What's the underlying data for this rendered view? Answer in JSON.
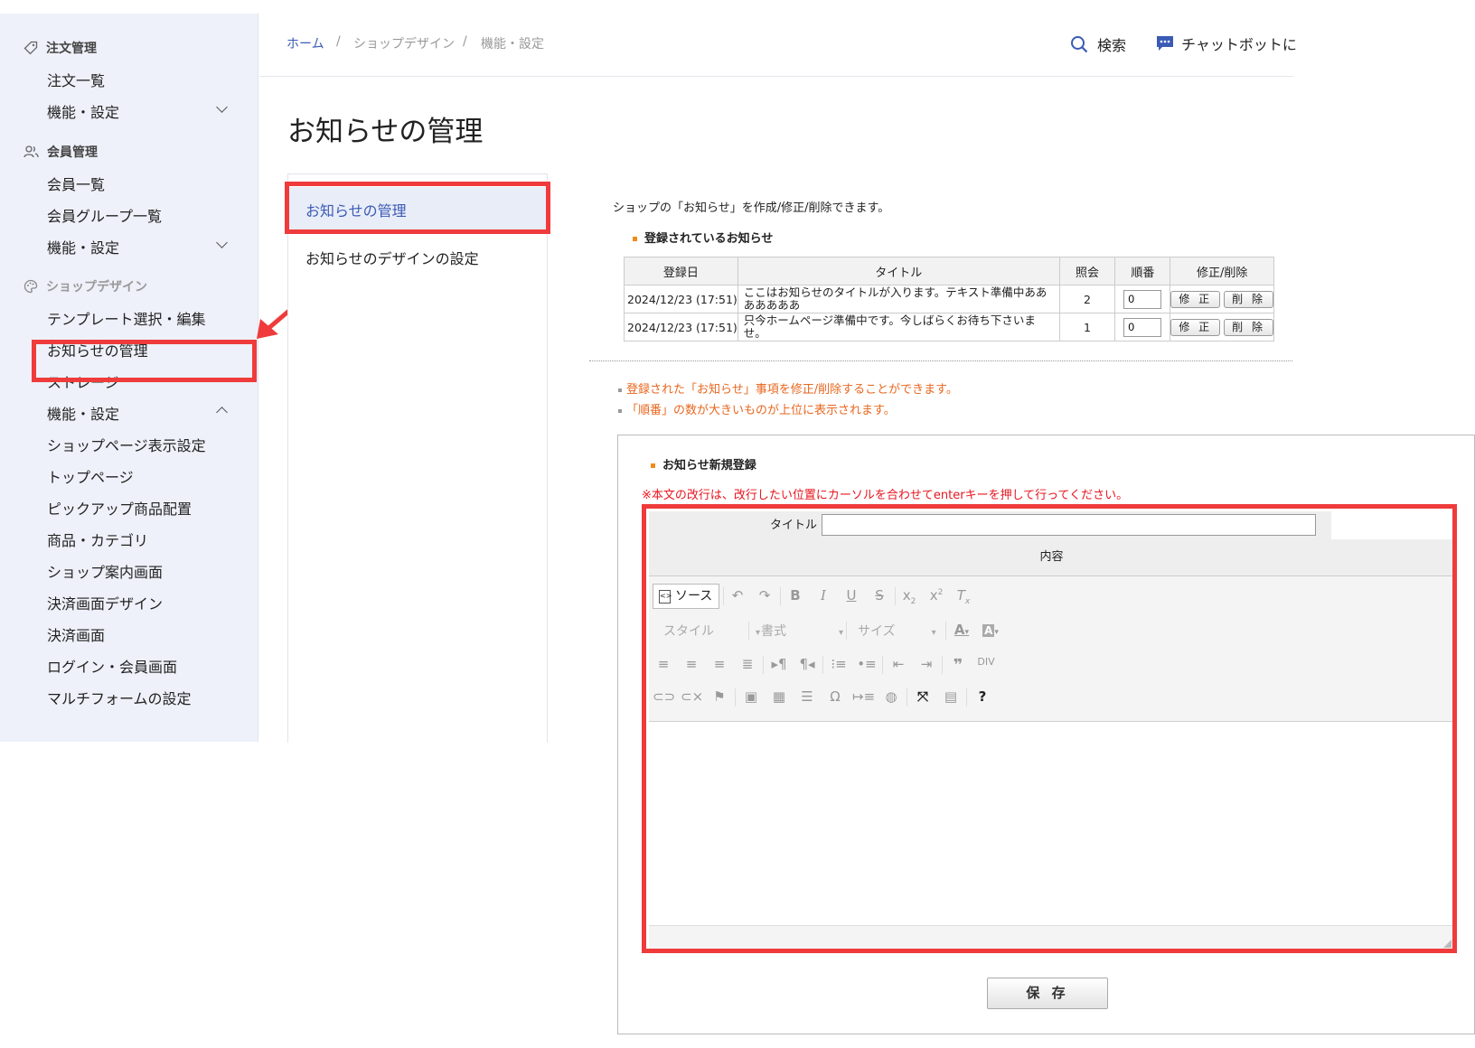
{
  "sidebar": {
    "sections": [
      {
        "title": "注文管理",
        "items": [
          "注文一覧",
          "機能・設定"
        ]
      },
      {
        "title": "会員管理",
        "items": [
          "会員一覧",
          "会員グループ一覧",
          "機能・設定"
        ]
      },
      {
        "title": "ショップデザイン",
        "items": [
          "テンプレート選択・編集",
          "お知らせの管理",
          "ストレージ",
          "機能・設定",
          "ショップページ表示設定",
          "トップページ",
          "ピックアップ商品配置",
          "商品・カテゴリ",
          "ショップ案内画面",
          "決済画面デザイン",
          "決済画面",
          "ログイン・会員画面",
          "マルチフォームの設定"
        ]
      }
    ]
  },
  "breadcrumb": [
    "ホーム",
    "ショップデザイン",
    "機能・設定"
  ],
  "header": {
    "search_label": "検索",
    "chatbot_label": "チャットボットに"
  },
  "page_title": "お知らせの管理",
  "subnav": [
    "お知らせの管理",
    "お知らせのデザインの設定"
  ],
  "content": {
    "intro": "ショップの「お知らせ」を作成/修正/削除できます。",
    "registered_heading": "登録されているお知らせ",
    "table": {
      "headers": [
        "登録日",
        "タイトル",
        "照会",
        "順番",
        "修正/削除"
      ],
      "rows": [
        {
          "date": "2024/12/23 (17:51)",
          "title": "ここはお知らせのタイトルが入ります。テキスト準備中あああああああ",
          "views": "2",
          "order": "0"
        },
        {
          "date": "2024/12/23 (17:51)",
          "title": "只今ホームページ準備中です。今しばらくお待ち下さいませ。",
          "views": "1",
          "order": "0"
        }
      ],
      "edit_label": "修 正",
      "delete_label": "削 除"
    },
    "notes": [
      "登録された「お知らせ」事項を修正/削除することができます。",
      "「順番」の数が大きいものが上位に表示されます。"
    ]
  },
  "form": {
    "heading": "お知らせ新規登録",
    "warning": "※本文の改行は、改行したい位置にカーソルを合わせてenterキーを押して行ってください。",
    "title_label": "タイトル",
    "title_value": "",
    "content_label": "内容",
    "source_label": "ソース",
    "style_label": "スタイル",
    "format_label": "書式",
    "size_label": "サイズ",
    "save_label": "保 存"
  },
  "colors": {
    "highlight": "#ef3b3b",
    "link": "#3a5bb5",
    "accent_bullet": "#f08c1a",
    "note": "#e8661e",
    "warning": "#e8141e"
  }
}
